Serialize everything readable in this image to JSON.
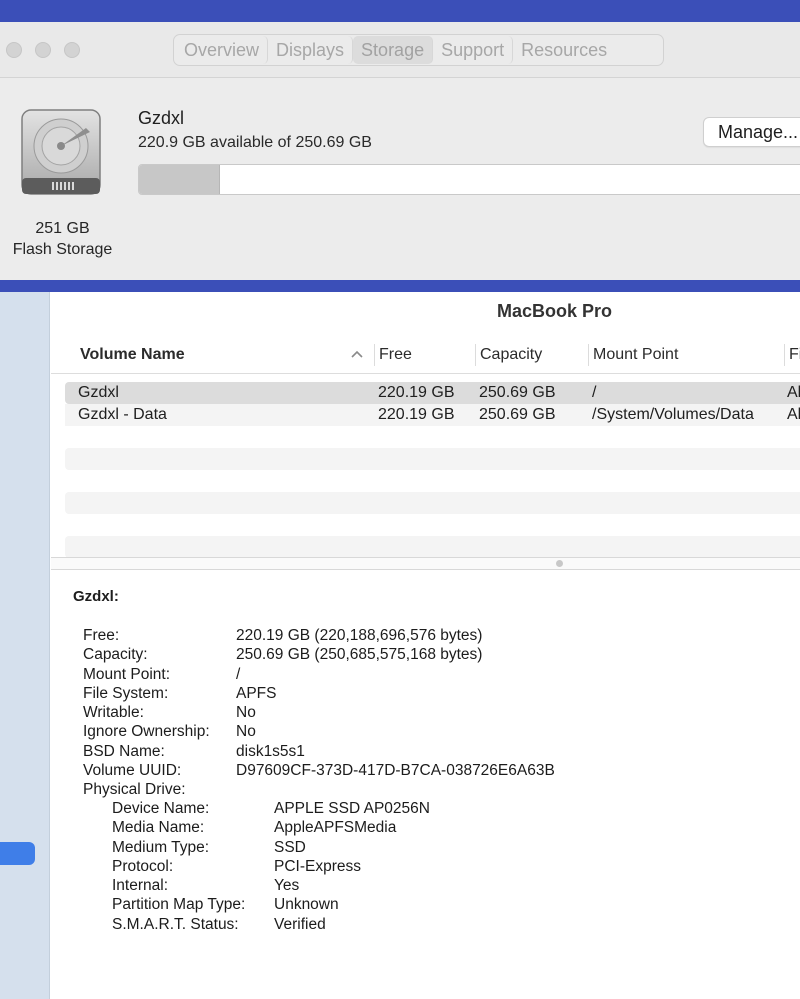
{
  "tabs": [
    "Overview",
    "Displays",
    "Storage",
    "Support",
    "Resources"
  ],
  "active_tab": "Storage",
  "storage": {
    "disk_name": "Gzdxl",
    "available_text": "220.9 GB available of 250.69 GB",
    "capacity_line1": "251 GB",
    "capacity_line2": "Flash Storage",
    "manage_label": "Manage...",
    "used_fraction": 0.119
  },
  "sysinfo": {
    "title": "MacBook Pro",
    "columns": [
      "Volume Name",
      "Free",
      "Capacity",
      "Mount Point",
      "Fi"
    ],
    "rows": [
      {
        "name": "Gzdxl",
        "free": "220.19 GB",
        "capacity": "250.69 GB",
        "mount": "/",
        "fs": "Al"
      },
      {
        "name": "Gzdxl - Data",
        "free": "220.19 GB",
        "capacity": "250.69 GB",
        "mount": "/System/Volumes/Data",
        "fs": "Al"
      }
    ],
    "detail_title": "Gzdxl:",
    "details": [
      {
        "label": "Free:",
        "value": "220.19 GB (220,188,696,576 bytes)"
      },
      {
        "label": "Capacity:",
        "value": "250.69 GB (250,685,575,168 bytes)"
      },
      {
        "label": "Mount Point:",
        "value": "/"
      },
      {
        "label": "File System:",
        "value": "APFS"
      },
      {
        "label": "Writable:",
        "value": "No"
      },
      {
        "label": "Ignore Ownership:",
        "value": "No"
      },
      {
        "label": "BSD Name:",
        "value": "disk1s5s1"
      },
      {
        "label": "Volume UUID:",
        "value": "D97609CF-373D-417D-B7CA-038726E6A63B"
      },
      {
        "label": "Physical Drive:",
        "value": ""
      }
    ],
    "physical_drive": [
      {
        "label": "Device Name:",
        "value": "APPLE SSD AP0256N"
      },
      {
        "label": "Media Name:",
        "value": "AppleAPFSMedia"
      },
      {
        "label": "Medium Type:",
        "value": "SSD"
      },
      {
        "label": "Protocol:",
        "value": "PCI-Express"
      },
      {
        "label": "Internal:",
        "value": "Yes"
      },
      {
        "label": "Partition Map Type:",
        "value": "Unknown"
      },
      {
        "label": "S.M.A.R.T. Status:",
        "value": "Verified"
      }
    ]
  },
  "colors": {
    "desktop": "#3b4fb8",
    "sidebar": "#d5e0ed",
    "selection": "#3f7ee8"
  }
}
